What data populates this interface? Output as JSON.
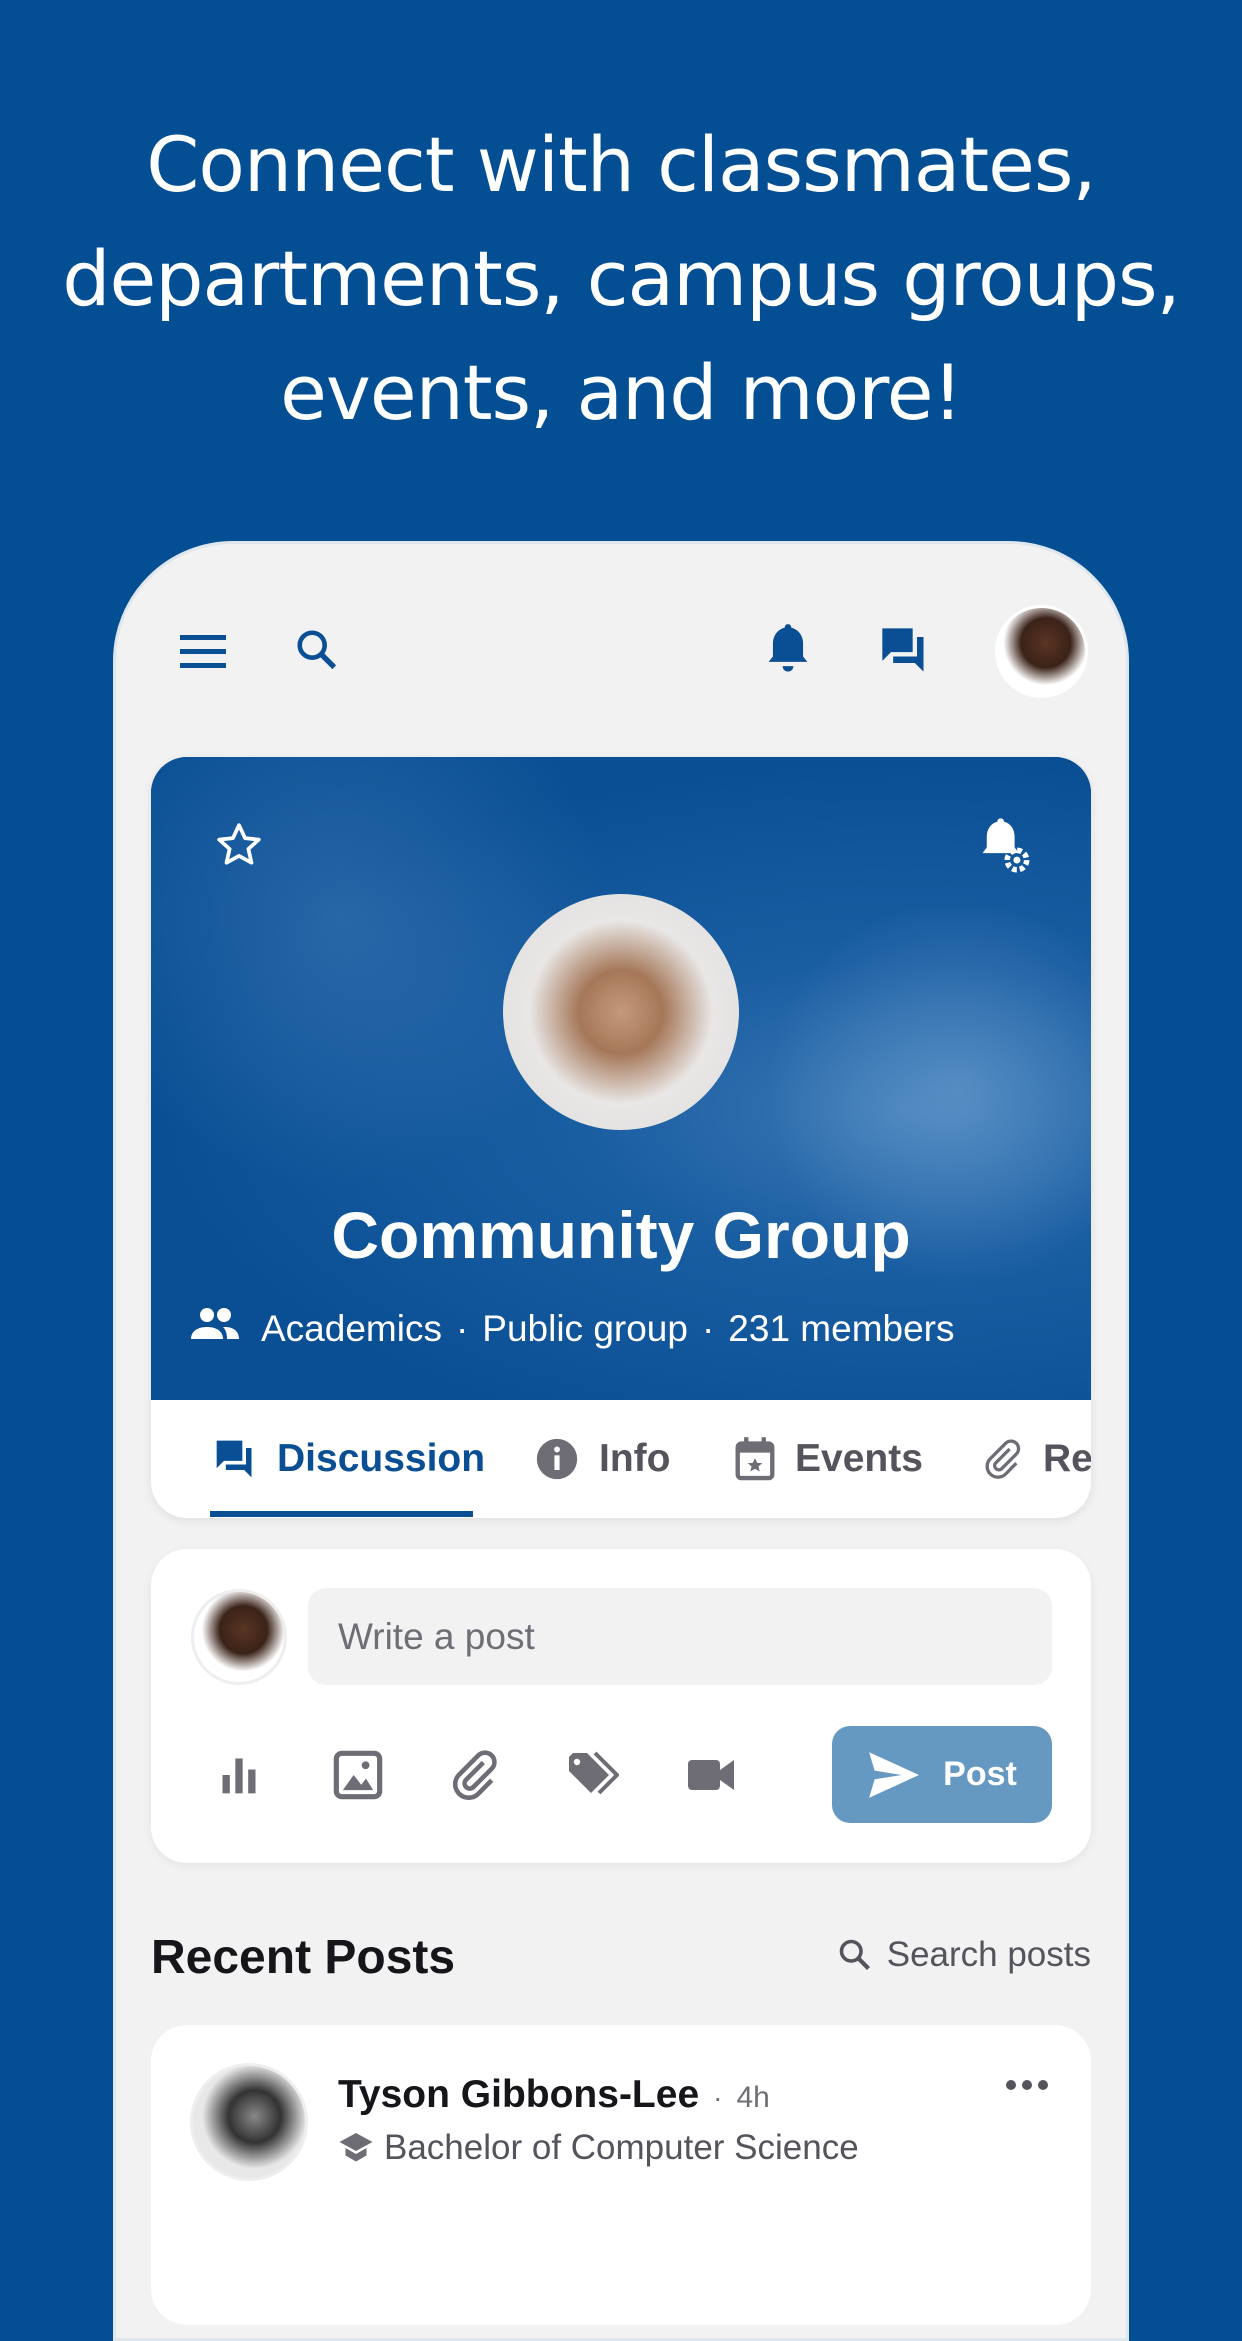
{
  "headline": [
    "Connect with classmates,",
    "departments, campus groups,",
    "events, and more!"
  ],
  "topbar": {
    "icons": [
      "menu-icon",
      "search-icon",
      "bell-icon",
      "chat-icon"
    ]
  },
  "group": {
    "title": "Community Group",
    "category": "Academics",
    "privacy": "Public group",
    "members": "231 members",
    "separator": "·"
  },
  "tabs": [
    {
      "label": "Discussion",
      "icon": "forum-icon",
      "active": true
    },
    {
      "label": "Info",
      "icon": "info-icon"
    },
    {
      "label": "Events",
      "icon": "calendar-icon"
    },
    {
      "label": "Re",
      "icon": "paperclip-icon"
    }
  ],
  "composer": {
    "placeholder": "Write a post",
    "post_label": "Post",
    "tools": [
      "poll-icon",
      "image-icon",
      "attach-icon",
      "tag-icon",
      "video-icon"
    ]
  },
  "recent": {
    "title": "Recent Posts",
    "search_label": "Search posts"
  },
  "post": {
    "author": "Tyson Gibbons-Lee",
    "time": "4h",
    "separator": "·",
    "program": "Bachelor of Computer Science"
  },
  "colors": {
    "brand": "#044f93",
    "post_button": "#6699c2",
    "background": "#f2f2f3"
  }
}
